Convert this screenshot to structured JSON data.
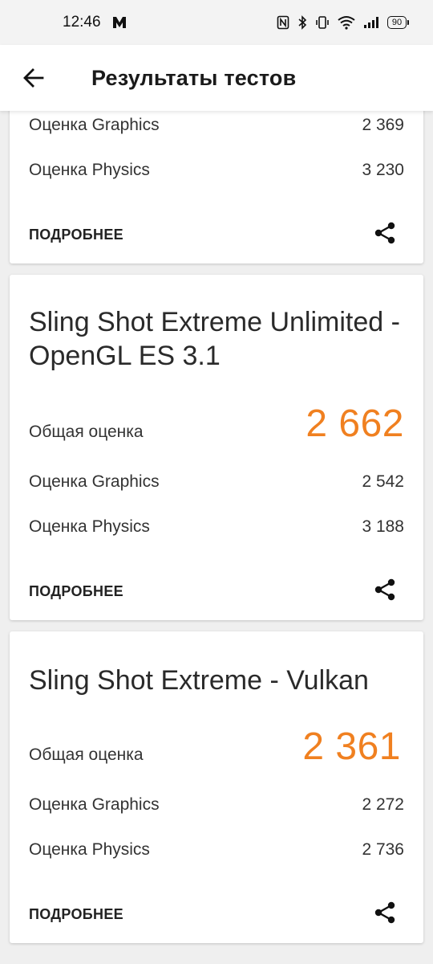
{
  "status_bar": {
    "time": "12:46",
    "battery": "90",
    "icons": [
      "m-app-icon",
      "nfc-icon",
      "bluetooth-icon",
      "vibrate-icon",
      "wifi-icon",
      "signal-icon",
      "battery-icon"
    ]
  },
  "app_bar": {
    "title": "Результаты тестов",
    "back_icon": "arrow-left-icon"
  },
  "cards": [
    {
      "title": "",
      "graphics_label": "Оценка Graphics",
      "graphics_value": "2 369",
      "physics_label": "Оценка Physics",
      "physics_value": "3 230",
      "more_label": "ПОДРОБНЕЕ",
      "share_icon": "share-icon"
    },
    {
      "title": "Sling Shot Extreme Unlimited - OpenGL ES 3.1",
      "total_label": "Общая оценка",
      "total_value": "2 662",
      "graphics_label": "Оценка Graphics",
      "graphics_value": "2 542",
      "physics_label": "Оценка Physics",
      "physics_value": "3 188",
      "more_label": "ПОДРОБНЕЕ",
      "share_icon": "share-icon"
    },
    {
      "title": "Sling Shot Extreme - Vulkan",
      "total_label": "Общая оценка",
      "total_value": "2 361",
      "graphics_label": "Оценка Graphics",
      "graphics_value": "2 272",
      "physics_label": "Оценка Physics",
      "physics_value": "2 736",
      "more_label": "ПОДРОБНЕЕ",
      "share_icon": "share-icon"
    }
  ],
  "colors": {
    "accent_score": "#f08020",
    "background": "#efefef",
    "card": "#ffffff"
  }
}
